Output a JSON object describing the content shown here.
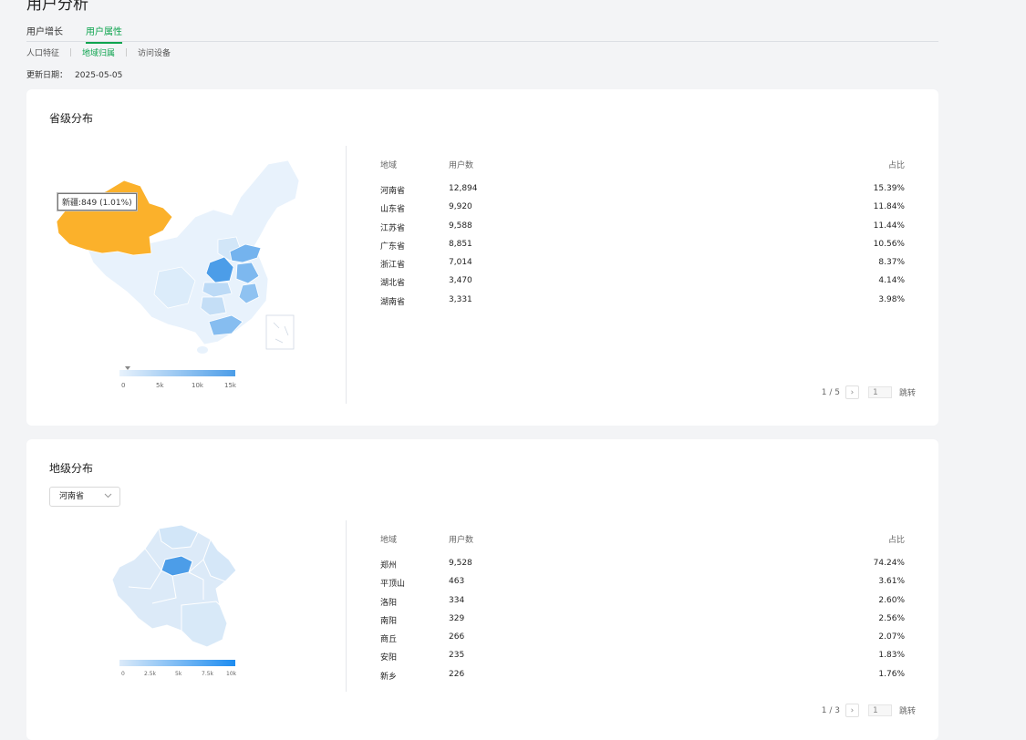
{
  "header": {
    "title": "用户分析",
    "tabs": [
      {
        "label": "用户增长",
        "active": false
      },
      {
        "label": "用户属性",
        "active": true
      }
    ],
    "subtabs": [
      {
        "label": "人口特征",
        "active": false
      },
      {
        "label": "地域归属",
        "active": true
      },
      {
        "label": "访问设备",
        "active": false
      }
    ],
    "update_label": "更新日期：",
    "update_date": "2025-05-05"
  },
  "colors": {
    "accent": "#0ea44f",
    "map_low": "#e8f2fc",
    "map_high": "#4c9de8",
    "highlight": "#fbb12b"
  },
  "province": {
    "title": "省级分布",
    "tooltip": "新疆:849 (1.01%)",
    "legend": {
      "ticks": [
        "0",
        "5k",
        "10k",
        "15k"
      ]
    },
    "columns": [
      "地域",
      "用户数",
      "占比"
    ],
    "rows": [
      [
        "河南省",
        "12,894",
        "15.39%"
      ],
      [
        "山东省",
        "9,920",
        "11.84%"
      ],
      [
        "江苏省",
        "9,588",
        "11.44%"
      ],
      [
        "广东省",
        "8,851",
        "10.56%"
      ],
      [
        "浙江省",
        "7,014",
        "8.37%"
      ],
      [
        "湖北省",
        "3,470",
        "4.14%"
      ],
      [
        "湖南省",
        "3,331",
        "3.98%"
      ]
    ],
    "pager": {
      "page": "1 / 5",
      "input": "1",
      "jump": "跳转"
    }
  },
  "city": {
    "title": "地级分布",
    "select_value": "河南省",
    "legend": {
      "ticks": [
        "0",
        "2.5k",
        "5k",
        "7.5k",
        "10k"
      ]
    },
    "columns": [
      "地域",
      "用户数",
      "占比"
    ],
    "rows": [
      [
        "郑州",
        "9,528",
        "74.24%"
      ],
      [
        "平顶山",
        "463",
        "3.61%"
      ],
      [
        "洛阳",
        "334",
        "2.60%"
      ],
      [
        "南阳",
        "329",
        "2.56%"
      ],
      [
        "商丘",
        "266",
        "2.07%"
      ],
      [
        "安阳",
        "235",
        "1.83%"
      ],
      [
        "新乡",
        "226",
        "1.76%"
      ]
    ],
    "pager": {
      "page": "1 / 3",
      "input": "1",
      "jump": "跳转"
    }
  }
}
